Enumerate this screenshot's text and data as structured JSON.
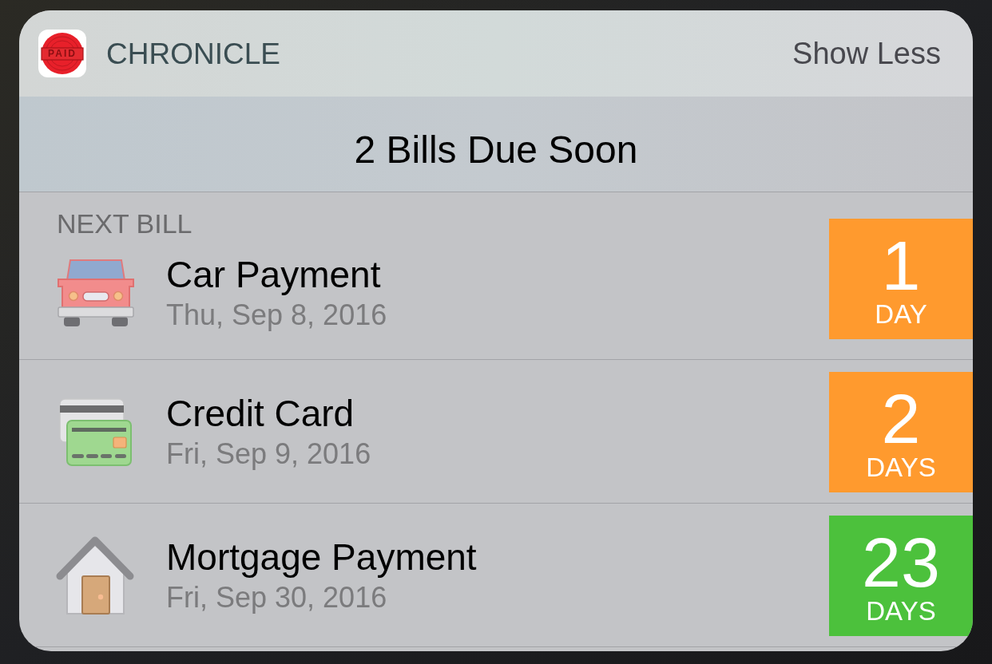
{
  "app": {
    "icon_label": "PAID",
    "name": "CHRONICLE",
    "action": "Show Less"
  },
  "summary": "2 Bills Due Soon",
  "bills": [
    {
      "section_label": "NEXT BILL",
      "kind": "car",
      "name": "Car Payment",
      "date": "Thu, Sep 8, 2016",
      "count": "1",
      "unit": "DAY",
      "color": "#ff9a2e"
    },
    {
      "kind": "card",
      "name": "Credit Card",
      "date": "Fri, Sep 9, 2016",
      "count": "2",
      "unit": "DAYS",
      "color": "#ff9a2e"
    },
    {
      "kind": "house",
      "name": "Mortgage Payment",
      "date": "Fri, Sep 30, 2016",
      "count": "23",
      "unit": "DAYS",
      "color": "#4cc13c"
    }
  ]
}
